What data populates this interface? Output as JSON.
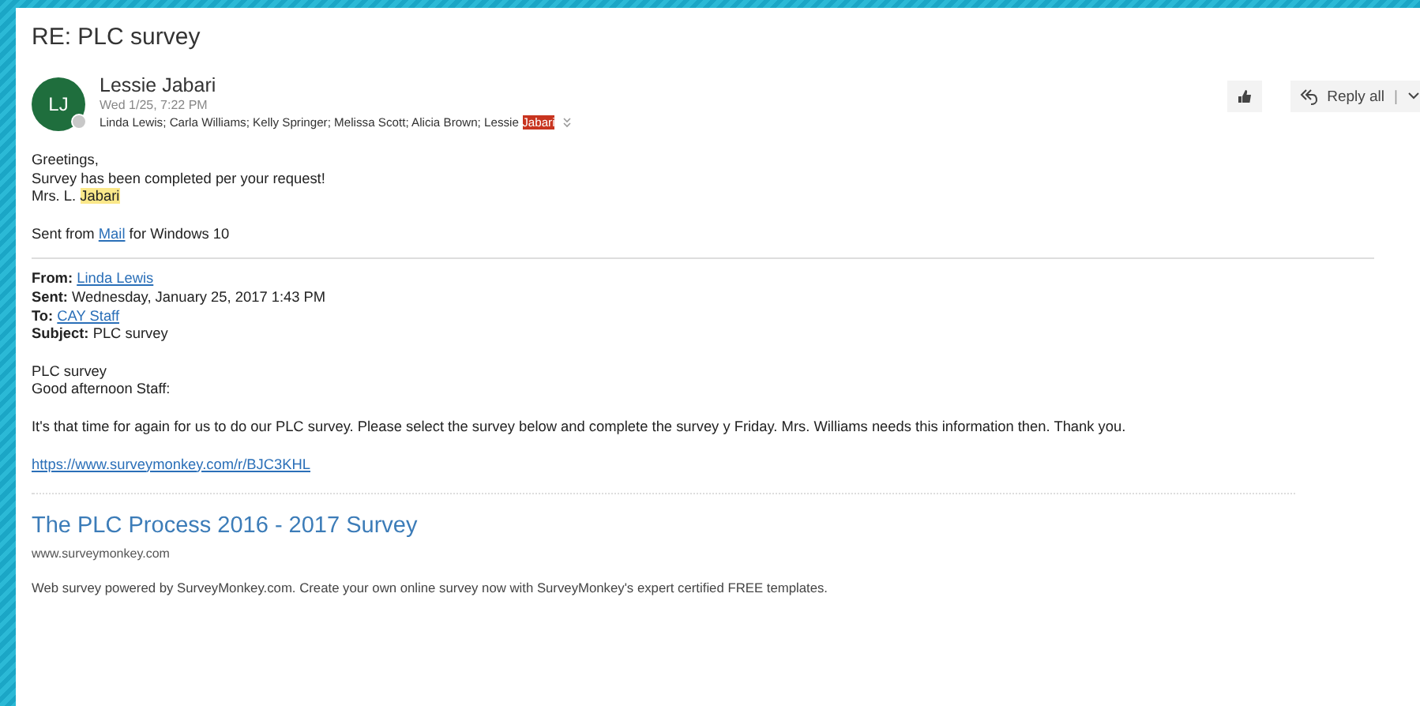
{
  "title": "RE: PLC survey",
  "sender": {
    "initials": "LJ",
    "name": "Lessie Jabari",
    "date": "Wed 1/25, 7:22 PM",
    "recipients": [
      {
        "kind": "text",
        "text": "Linda Lewis; Carla Williams; Kelly Springer; Melissa Scott; Alicia Brown; Lessie "
      },
      {
        "kind": "mark",
        "text": "Jabari",
        "color": "#c8341f"
      }
    ]
  },
  "actions": {
    "reply_all": "Reply all",
    "separator": "|"
  },
  "reply_body": [
    [
      {
        "kind": "text",
        "text": "Greetings,"
      }
    ],
    [
      {
        "kind": "text",
        "text": "Survey has been completed per your request!"
      }
    ],
    [
      {
        "kind": "text",
        "text": "Mrs. L. "
      },
      {
        "kind": "mark",
        "text": "Jabari",
        "color": "#fbe88a"
      }
    ]
  ],
  "signature": [
    {
      "kind": "text",
      "text": "Sent from "
    },
    {
      "kind": "link",
      "text": "Mail"
    },
    {
      "kind": "text",
      "text": " for Windows 10"
    }
  ],
  "original_header": [
    {
      "label": "From:",
      "value": "Linda Lewis",
      "kind": "link"
    },
    {
      "label": "Sent:",
      "value": "Wednesday, January 25, 2017 1:43 PM",
      "kind": "text"
    },
    {
      "label": "To:",
      "value": "CAY Staff",
      "kind": "link"
    },
    {
      "label": "Subject:",
      "value": "PLC survey",
      "kind": "text"
    }
  ],
  "original_body": [
    "PLC survey",
    "Good afternoon Staff:"
  ],
  "message": "It's that time for again for us to do our PLC survey.  Please select the survey below and complete the survey y Friday.  Mrs. Williams needs this information then.  Thank you.",
  "url": "https://www.surveymonkey.com/r/BJC3KHL",
  "preview": {
    "title": "The PLC Process 2016 - 2017 Survey",
    "domain": "www.surveymonkey.com",
    "description": "Web survey powered by SurveyMonkey.com. Create your own online survey now with SurveyMonkey's expert certified FREE templates."
  }
}
